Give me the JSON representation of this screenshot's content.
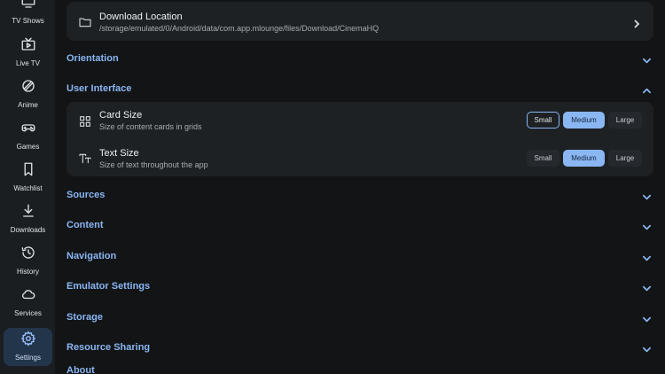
{
  "sidebar": {
    "items": [
      {
        "label": "TV Shows",
        "icon": "tv-icon"
      },
      {
        "label": "Live TV",
        "icon": "live-tv-icon"
      },
      {
        "label": "Anime",
        "icon": "anime-icon"
      },
      {
        "label": "Games",
        "icon": "gamepad-icon"
      },
      {
        "label": "Watchlist",
        "icon": "bookmark-icon"
      },
      {
        "label": "Downloads",
        "icon": "download-icon"
      },
      {
        "label": "History",
        "icon": "history-icon"
      },
      {
        "label": "Services",
        "icon": "cloud-icon"
      },
      {
        "label": "Settings",
        "icon": "gear-icon",
        "active": true
      }
    ]
  },
  "download_location": {
    "title": "Download Location",
    "path": "/storage/emulated/0/Android/data/com.app.mlounge/files/Download/CinemaHQ"
  },
  "sections": {
    "orientation": "Orientation",
    "user_interface": "User Interface",
    "sources": "Sources",
    "content": "Content",
    "navigation": "Navigation",
    "emulator_settings": "Emulator Settings",
    "storage": "Storage",
    "resource_sharing": "Resource Sharing",
    "about": "About"
  },
  "user_interface": {
    "card_size": {
      "title": "Card Size",
      "subtitle": "Size of content cards in grids",
      "options": [
        "Small",
        "Medium",
        "Large"
      ],
      "selected": "Medium",
      "focused": "Small"
    },
    "text_size": {
      "title": "Text Size",
      "subtitle": "Size of text throughout the app",
      "options": [
        "Small",
        "Medium",
        "Large"
      ],
      "selected": "Medium"
    }
  },
  "colors": {
    "accent": "#8ab6f2",
    "background": "#121416",
    "card": "#1e2124",
    "sidebar": "#1b1e21"
  }
}
